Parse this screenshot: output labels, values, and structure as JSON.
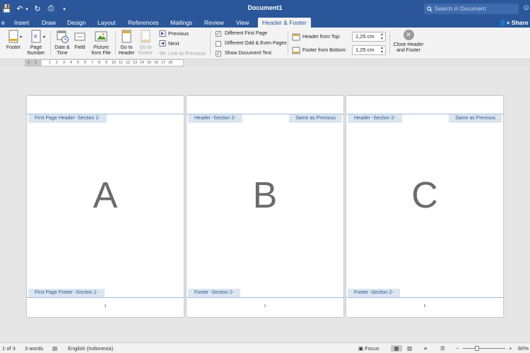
{
  "window": {
    "title": "Document1",
    "search_placeholder": "Search in Document",
    "profile_icon": "☺"
  },
  "quick_access": {
    "save_icon": "💾",
    "undo_icon": "↶",
    "undo_menu_icon": "▾",
    "redo_icon": "↻",
    "print_icon": "⎙",
    "customize_icon": "▾"
  },
  "tabs": [
    {
      "label": "e"
    },
    {
      "label": "Insert"
    },
    {
      "label": "Draw"
    },
    {
      "label": "Design"
    },
    {
      "label": "Layout"
    },
    {
      "label": "References"
    },
    {
      "label": "Mailings"
    },
    {
      "label": "Review"
    },
    {
      "label": "View"
    },
    {
      "label": "Header & Footer"
    }
  ],
  "share_label": "Share",
  "ribbon": {
    "footer": "Footer",
    "page_number": [
      "Page",
      "Number"
    ],
    "date_time": [
      "Date &",
      "Time"
    ],
    "field": "Field",
    "picture": [
      "Picture",
      "from File"
    ],
    "go_to_header": [
      "Go to",
      "Header"
    ],
    "go_to_footer": [
      "Go to",
      "Footer"
    ],
    "previous": "Previous",
    "next": "Next",
    "link_to_previous": "Link to Previous",
    "different_first_page": "Different First Page",
    "different_odd_even": "Different Odd & Even Pages",
    "show_document_text": "Show Document Text",
    "checks": {
      "different_first_page": true,
      "different_odd_even": false,
      "show_document_text": true
    },
    "check_mark": "✓",
    "header_from_top_label": "Header from Top:",
    "header_from_top_value": "1,25 cm",
    "footer_from_bottom_label": "Footer from Bottom:",
    "footer_from_bottom_value": "1,25 cm",
    "spin_up": "▲",
    "spin_down": "▼",
    "close_header_footer": [
      "Close Header",
      "and Footer"
    ],
    "close_icon": "✕"
  },
  "ruler_marks": [
    "2",
    "1",
    "1",
    "2",
    "3",
    "4",
    "5",
    "6",
    "7",
    "8",
    "9",
    "10",
    "11",
    "12",
    "13",
    "14",
    "15",
    "16",
    "17",
    "18"
  ],
  "pages": [
    {
      "header_tag": "First Page Header -Section 1-",
      "footer_tag": "First Page Footer -Section 1-",
      "same_as_previous": "",
      "letter": "A",
      "page_number": "1"
    },
    {
      "header_tag": "Header -Section 2-",
      "footer_tag": "Footer -Section 2-",
      "same_as_previous": "Same as Previous",
      "letter": "B",
      "page_number": "1"
    },
    {
      "header_tag": "Header -Section 2-",
      "footer_tag": "Footer -Section 2-",
      "same_as_previous": "Same as Previous",
      "letter": "C",
      "page_number": "2"
    }
  ],
  "status": {
    "page": "1 of 3",
    "words": "3 words",
    "proofing_icon": "▤",
    "language": "English (Indonesia)",
    "focus": "Focus",
    "focus_icon": "▣",
    "print_layout_icon": "▦",
    "web_layout_icon": "▥",
    "outline_icon": "≡",
    "draft_icon": "☰",
    "zoom_out": "−",
    "zoom_in": "+",
    "zoom_level": 60,
    "zoom": "60%"
  },
  "colors": {
    "title_bar": "#2b579a",
    "ribbon": "#f3f3f3",
    "tag_bg": "#dbe6f2",
    "tag_text": "#2f5a8a"
  }
}
